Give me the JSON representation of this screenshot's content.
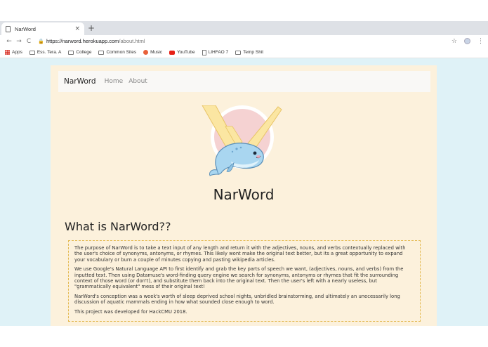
{
  "browser": {
    "tab_title": "NarWord",
    "tab_close": "×",
    "new_tab": "+",
    "url_host": "https://narword.herokuapp.com",
    "url_path": "/about.html",
    "back": "←",
    "forward": "→",
    "reload": "C",
    "star": "☆",
    "menu": "⋮",
    "bookmarks": [
      {
        "label": "Apps",
        "icon": "apps-grid-icon"
      },
      {
        "label": "Ess. Tera. A",
        "icon": "folder-icon"
      },
      {
        "label": "College",
        "icon": "folder-icon"
      },
      {
        "label": "Common Sites",
        "icon": "folder-icon"
      },
      {
        "label": "Music",
        "icon": "music-icon"
      },
      {
        "label": "YouTube",
        "icon": "youtube-icon"
      },
      {
        "label": "LIHFAO 7",
        "icon": "file-icon"
      },
      {
        "label": "Temp Shit",
        "icon": "folder-icon"
      }
    ]
  },
  "site": {
    "brand": "NarWord",
    "nav": [
      "Home",
      "About"
    ],
    "title": "NarWord",
    "about_heading": "What is NarWord??",
    "paragraphs": [
      "The purpose of NarWord is to take a text input of any length and return it with the adjectives, nouns, and verbs contextually replaced with the user's choice of synonyms, antonyms, or rhymes. This likely wont make the original text better, but its a great opportunity to expand your vocabulary or burn a couple of minutes copying and pasting wikipedia articles.",
      "We use Google's Natural Language API to first identify and grab the key parts of speech we want, (adjectives, nouns, and verbs) from the inputted text. Then using Datamuse's word-finding query engine we search for synonyms, antonyms or rhymes that fit the surrounding context of those word (or don't), and substitute them back into the original text. Then the user's left with a nearly useless, but \"grammatically equivalent\" mess of their original text!",
      "NarWord's conception was a week's worth of sleep deprived school nights, unbridled brainstorming, and ultimately an unecessarily long discussion of aquatic mammals ending in how what sounded close enough to word.",
      "This project was developed for HackCMU 2018."
    ]
  },
  "colors": {
    "background": "#dff2f7",
    "page": "#fcf1dc",
    "border_accent": "#e3b84e"
  }
}
